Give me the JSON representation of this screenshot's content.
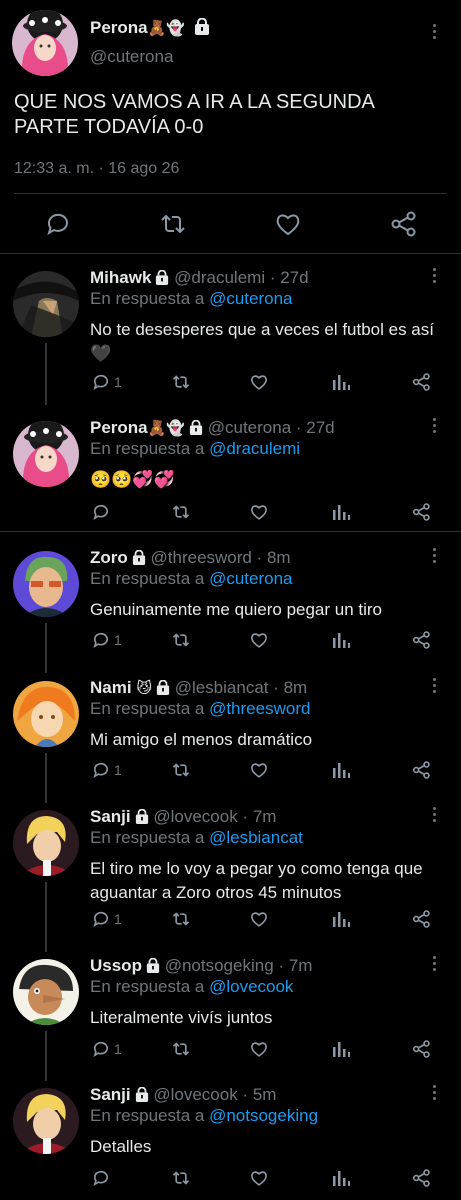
{
  "main_tweet": {
    "name": "Perona",
    "name_emoji": "🧸👻",
    "handle": "@cuterona",
    "text": "QUE NOS VAMOS A IR A LA SEGUNDA PARTE TODAVÍA 0-0",
    "timestamp": "12:33 a. m. · 16 ago 26",
    "icons": [
      "reply-icon",
      "retweet-icon",
      "like-icon",
      "share-icon"
    ]
  },
  "reply_prefix": "En respuesta a ",
  "replies": [
    {
      "name": "Mihawk",
      "emoji": "",
      "handle": "@draculemi · 27d",
      "reply_to": "@cuterona",
      "text": "No te desesperes que a veces el futbol es así 🖤",
      "reply_count": "1"
    },
    {
      "name": "Perona",
      "emoji": "🧸👻",
      "handle": "@cuterona · 27d",
      "reply_to": "@draculemi",
      "text": "🥺🥺💞💞",
      "reply_count": ""
    },
    {
      "name": "Zoro",
      "emoji": "",
      "handle": "@threesword · 8m",
      "reply_to": "@cuterona",
      "text": "Genuinamente me quiero pegar un tiro",
      "reply_count": "1"
    },
    {
      "name": "Nami",
      "emoji": "😼",
      "handle": "@lesbiancat · 8m",
      "reply_to": "@threesword",
      "text": "Mi amigo el menos dramático",
      "reply_count": "1"
    },
    {
      "name": "Sanji",
      "emoji": "",
      "handle": "@lovecook · 7m",
      "reply_to": "@lesbiancat",
      "text": "El tiro me lo voy a pegar yo como tenga que aguantar a Zoro otros 45 minutos",
      "reply_count": "1"
    },
    {
      "name": "Ussop",
      "emoji": "",
      "handle": "@notsogeking · 7m",
      "reply_to": "@lovecook",
      "text": "Literalmente vivís juntos",
      "reply_count": "1"
    },
    {
      "name": "Sanji",
      "emoji": "",
      "handle": "@lovecook · 5m",
      "reply_to": "@notsogeking",
      "text": "Detalles",
      "reply_count": ""
    }
  ],
  "colors": {
    "background": "#000000",
    "text": "#e7e9ea",
    "muted": "#71767b",
    "link": "#1d9bf0",
    "divider": "#2f3336"
  }
}
